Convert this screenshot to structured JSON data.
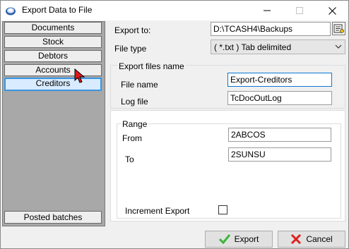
{
  "window": {
    "title": "Export Data to File",
    "minimize_glyph": "—",
    "maximize_glyph": "☐",
    "close_glyph": "✕"
  },
  "sidebar": {
    "items": [
      {
        "label": "Documents"
      },
      {
        "label": "Stock"
      },
      {
        "label": "Debtors"
      },
      {
        "label": "Accounts"
      },
      {
        "label": "Creditors",
        "selected": true
      }
    ],
    "bottom_item": {
      "label": "Posted batches"
    }
  },
  "form": {
    "export_to_label": "Export to:",
    "export_to_value": "D:\\TCASH4\\Backups",
    "file_type_label": "File type",
    "file_type_value": "( *.txt )   Tab delimited",
    "export_files_group": "Export files name",
    "file_name_label": "File name",
    "file_name_value": "Export-Creditors",
    "log_file_label": "Log file",
    "log_file_value": "TcDocOutLog",
    "range_group": "Range",
    "from_label": "From",
    "from_value": "2ABCOS",
    "to_label": "To",
    "to_value": "2SUNSU",
    "increment_label": "Increment Export",
    "increment_checked": false
  },
  "buttons": {
    "export_label": "Export",
    "cancel_label": "Cancel"
  },
  "colors": {
    "accent": "#0a78d7",
    "selected_nav": "#3a95e0",
    "sidebar_bg": "#a8a8a8",
    "export_icon": "#3cb43c",
    "cancel_icon": "#e02020"
  },
  "icons": [
    "app-icon",
    "browse-icon",
    "chevron-down-icon",
    "checkmark-icon",
    "cancel-x-icon",
    "mouse-cursor-icon"
  ]
}
